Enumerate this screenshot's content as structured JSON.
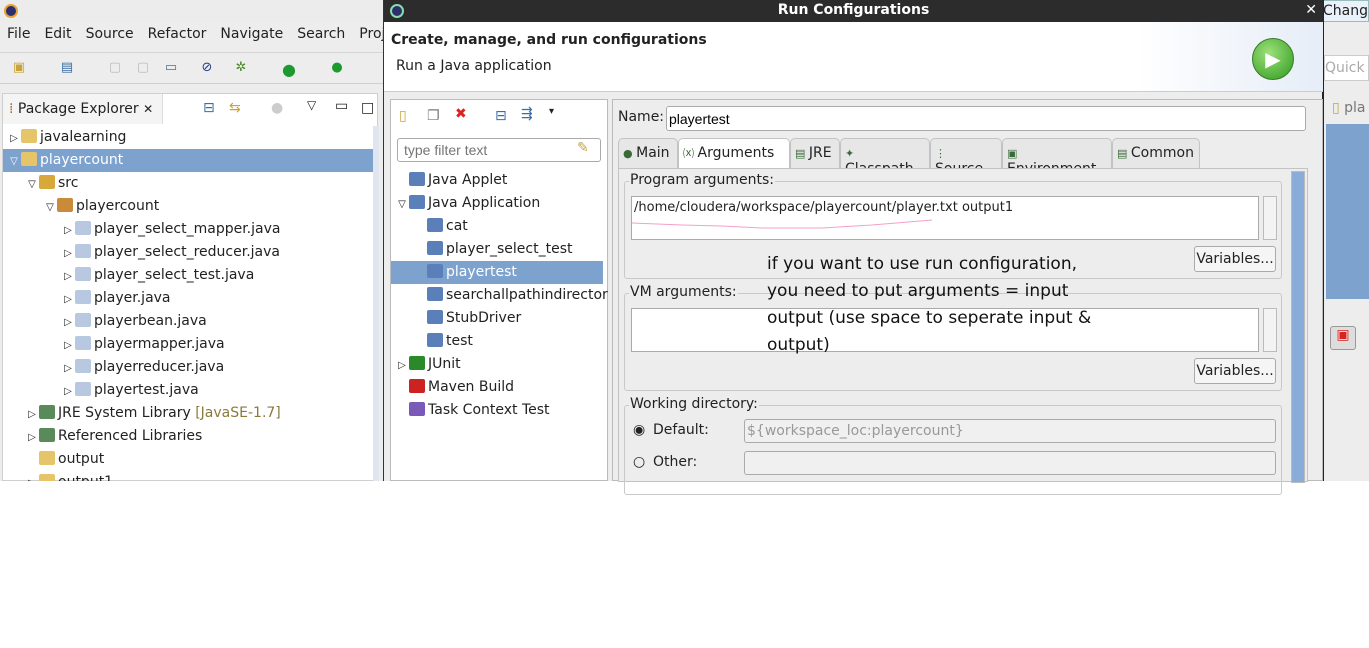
{
  "ide": {
    "menu": [
      "File",
      "Edit",
      "Source",
      "Refactor",
      "Navigate",
      "Search",
      "Project"
    ],
    "quick_access_placeholder": "Quick A",
    "tooltip": "Change",
    "editor_tab": "pla",
    "package_explorer": {
      "title": "Package Explorer",
      "items": [
        {
          "label": "javalearning",
          "level": 0,
          "twisty": "▷",
          "icon": "project-icon"
        },
        {
          "label": "playercount",
          "level": 0,
          "twisty": "▽",
          "icon": "project-icon",
          "selected": true
        },
        {
          "label": "src",
          "level": 1,
          "twisty": "▽",
          "icon": "source-folder-icon"
        },
        {
          "label": "playercount",
          "level": 2,
          "twisty": "▽",
          "icon": "package-icon"
        },
        {
          "label": "player_select_mapper.java",
          "level": 3,
          "twisty": "▷",
          "icon": "java-file-warning-icon"
        },
        {
          "label": "player_select_reducer.java",
          "level": 3,
          "twisty": "▷",
          "icon": "java-file-warning-icon"
        },
        {
          "label": "player_select_test.java",
          "level": 3,
          "twisty": "▷",
          "icon": "java-file-warning-icon"
        },
        {
          "label": "player.java",
          "level": 3,
          "twisty": "▷",
          "icon": "java-file-icon"
        },
        {
          "label": "playerbean.java",
          "level": 3,
          "twisty": "▷",
          "icon": "java-file-icon"
        },
        {
          "label": "playermapper.java",
          "level": 3,
          "twisty": "▷",
          "icon": "java-file-warning-icon"
        },
        {
          "label": "playerreducer.java",
          "level": 3,
          "twisty": "▷",
          "icon": "java-file-warning-icon"
        },
        {
          "label": "playertest.java",
          "level": 3,
          "twisty": "▷",
          "icon": "java-file-warning-icon"
        },
        {
          "label": "JRE System Library",
          "suffix": "[JavaSE-1.7]",
          "level": 1,
          "twisty": "▷",
          "icon": "library-icon"
        },
        {
          "label": "Referenced Libraries",
          "level": 1,
          "twisty": "▷",
          "icon": "library-icon"
        },
        {
          "label": "output",
          "level": 1,
          "twisty": "",
          "icon": "folder-icon"
        },
        {
          "label": "output1",
          "level": 1,
          "twisty": "▷",
          "icon": "folder-icon"
        }
      ]
    }
  },
  "dialog": {
    "title": "Run Configurations",
    "heading": "Create, manage, and run configurations",
    "subheading": "Run a Java application",
    "filter_placeholder": "type filter text",
    "config_tree": [
      {
        "label": "Java Applet",
        "level": 0,
        "twisty": "",
        "icon": "applet-icon"
      },
      {
        "label": "Java Application",
        "level": 0,
        "twisty": "▽",
        "icon": "java-app-icon"
      },
      {
        "label": "cat",
        "level": 1,
        "icon": "java-config-icon"
      },
      {
        "label": "player_select_test",
        "level": 1,
        "icon": "java-config-icon"
      },
      {
        "label": "playertest",
        "level": 1,
        "icon": "java-config-icon",
        "selected": true
      },
      {
        "label": "searchallpathindirector",
        "level": 1,
        "icon": "java-config-icon"
      },
      {
        "label": "StubDriver",
        "level": 1,
        "icon": "java-config-icon"
      },
      {
        "label": "test",
        "level": 1,
        "icon": "java-config-icon"
      },
      {
        "label": "JUnit",
        "level": 0,
        "twisty": "▷",
        "icon": "junit-icon"
      },
      {
        "label": "Maven Build",
        "level": 0,
        "twisty": "",
        "icon": "maven-icon"
      },
      {
        "label": "Task Context Test",
        "level": 0,
        "twisty": "",
        "icon": "task-context-icon"
      }
    ],
    "name_label": "Name:",
    "name_value": "playertest",
    "tabs": [
      "Main",
      "Arguments",
      "JRE",
      "Classpath",
      "Source",
      "Environment",
      "Common"
    ],
    "active_tab": "Arguments",
    "program_args_label": "Program arguments:",
    "program_args_value": "/home/cloudera/workspace/playercount/player.txt output1",
    "variables_label": "Variables...",
    "vm_args_label": "VM arguments:",
    "vm_args_value": "",
    "working_dir_label": "Working directory:",
    "default_label": "Default:",
    "default_value": "${workspace_loc:playercount}",
    "other_label": "Other:",
    "other_value": "",
    "annotation": [
      "if you want to use run configuration,",
      "you need to put arguments = input",
      "output (use space to seperate input &",
      "output)"
    ]
  }
}
